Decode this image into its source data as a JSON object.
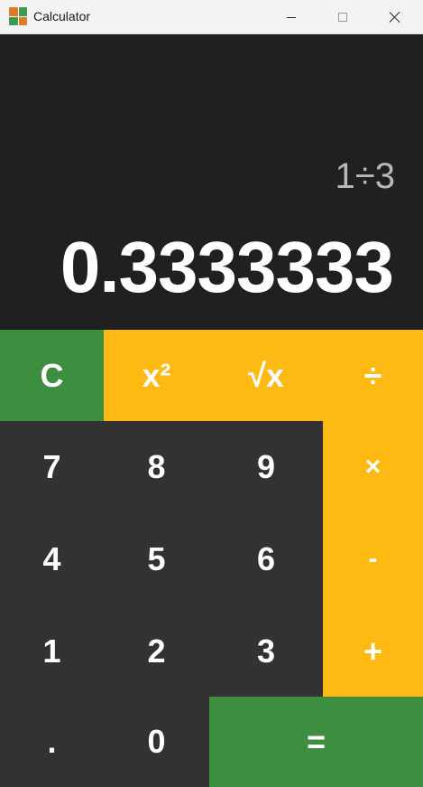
{
  "window": {
    "title": "Calculator",
    "icon": "calculator-app-icon",
    "controls": {
      "minimize": "minimize-icon",
      "maximize": "maximize-icon",
      "close": "close-icon"
    }
  },
  "display": {
    "expression": "1÷3",
    "result": "0.3333333"
  },
  "keys": {
    "clear": "C",
    "square": "x²",
    "sqrt": "√x",
    "divide": "÷",
    "seven": "7",
    "eight": "8",
    "nine": "9",
    "multiply": "×",
    "four": "4",
    "five": "5",
    "six": "6",
    "subtract": "-",
    "one": "1",
    "two": "2",
    "three": "3",
    "add": "+",
    "decimal": ".",
    "zero": "0",
    "equals": "="
  },
  "colors": {
    "display_bg": "#202020",
    "digit_key_bg": "#323232",
    "operator_bg": "#ffb912",
    "action_green": "#3e8e41",
    "expression_text": "#b9b9b9",
    "result_text": "#ffffff"
  }
}
